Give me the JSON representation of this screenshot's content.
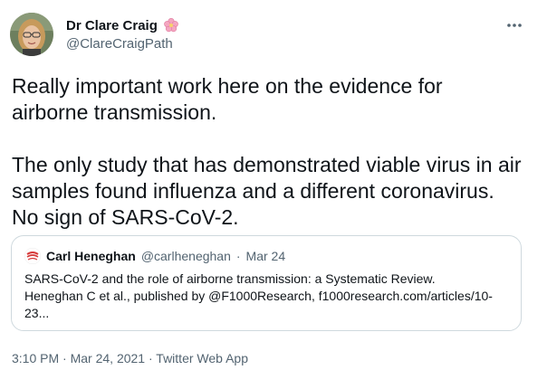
{
  "author": {
    "display_name": "Dr Clare Craig",
    "handle": "@ClareCraigPath",
    "avatar_icon": "user-avatar-photo",
    "badge_icon": "cherry-blossom-icon"
  },
  "more_icon": "more-horizontal-icon",
  "tweet": {
    "paragraph_1_line_1": "Really important work here on the evidence for",
    "paragraph_1_line_2": "airborne transmission.",
    "paragraph_2_line_1": "The only study that has demonstrated viable virus in air",
    "paragraph_2_line_2": "samples found influenza and a different coronavirus.",
    "paragraph_2_line_3": "No sign of SARS-CoV-2."
  },
  "quote": {
    "display_name": "Carl Heneghan",
    "handle": "@carlheneghan",
    "separator": "·",
    "date": "Mar 24",
    "body_line_1": "SARS-CoV-2 and the role of airborne transmission: a Systematic Review.",
    "body_line_2": "Heneghan C et al., published by @F1000Research, f1000research.com/articles/10-",
    "body_line_3": "23...",
    "avatar_icon": "quoted-user-avatar"
  },
  "footer": {
    "time": "3:10 PM",
    "separator_1": "·",
    "date": "Mar 24, 2021",
    "separator_2": "·",
    "source": "Twitter Web App"
  },
  "colors": {
    "text_primary": "#0f1419",
    "text_secondary": "#536471",
    "border": "#cfd9de"
  }
}
